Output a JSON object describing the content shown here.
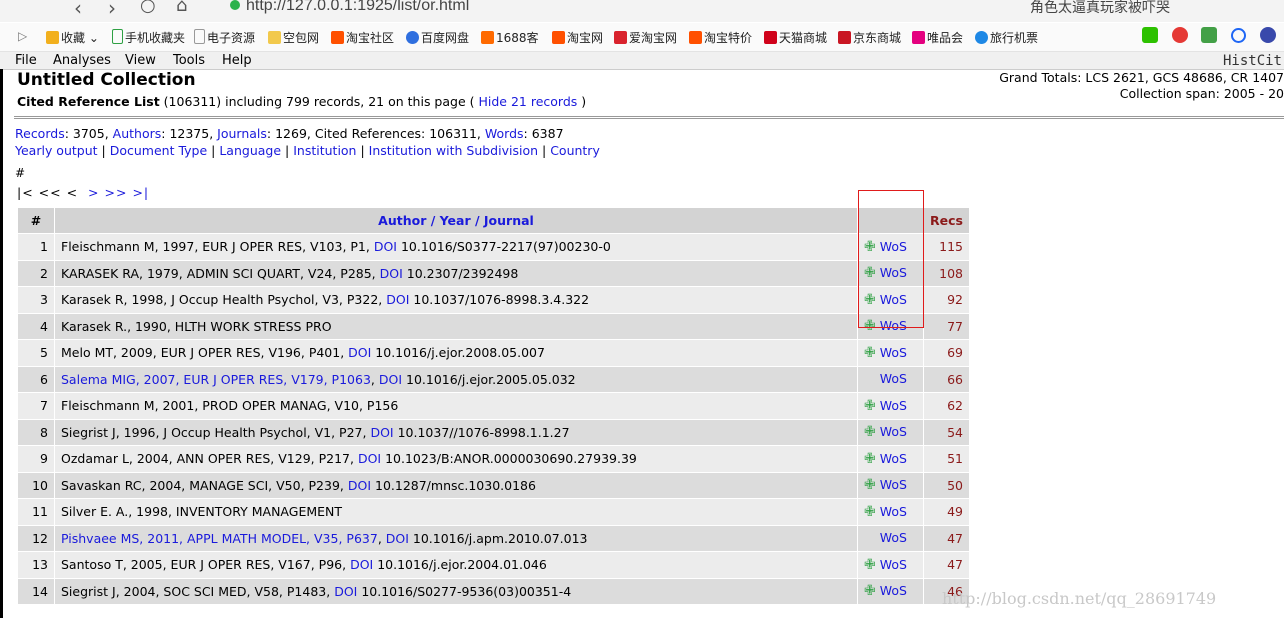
{
  "browser": {
    "url": "http://127.0.0.1:1925/list/or.html",
    "tab_title": "角色太逼真玩家被吓哭",
    "bookmarks": [
      "收藏",
      "手机收藏夹",
      "电子资源",
      "空包网",
      "淘宝社区",
      "百度网盘",
      "1688客",
      "淘宝网",
      "爱淘宝网",
      "淘宝特价",
      "天猫商城",
      "京东商城",
      "唯品会",
      "旅行机票"
    ]
  },
  "menu": {
    "items": [
      "File",
      "Analyses",
      "View",
      "Tools",
      "Help"
    ],
    "brand": "HistCit"
  },
  "header": {
    "title": "Untitled Collection",
    "cited_label": "Cited Reference List",
    "cited_info": " (106311) including 799 records, 21 on this page ( ",
    "hide_link": "Hide 21 records",
    "close_paren": " )",
    "grand_totals": "Grand Totals: LCS 2621, GCS 48686, CR 1407",
    "span": "Collection span: 2005 - 20"
  },
  "stats": {
    "records_label": "Records",
    "records_val": ": 3705, ",
    "authors_label": "Authors",
    "authors_val": ": 12375, ",
    "journals_label": "Journals",
    "journals_val": ": 1269, Cited References: 106311, ",
    "words_label": "Words",
    "words_val": ": 6387",
    "links": [
      "Yearly output",
      "Document Type",
      "Language",
      "Institution",
      "Institution with Subdivision",
      "Country"
    ]
  },
  "hash": "#",
  "pager": {
    "first": "|<",
    "prevprev": "<<",
    "prev": "<",
    "next": ">",
    "nextnext": ">>",
    "last": ">|"
  },
  "table": {
    "col_num": "#",
    "col_author": "Author",
    "col_year": "Year",
    "col_journal": "Journal",
    "col_recs": "Recs",
    "wos_label": "WoS",
    "plus_glyph": "✙",
    "rows": [
      {
        "n": "1",
        "ref": "Fleischmann M, 1997, EUR J OPER RES, V103, P1, ",
        "doi": "DOI",
        "doi_val": " 10.1016/S0377-2217(97)00230-0",
        "recs": "115",
        "plus": true,
        "linked": false
      },
      {
        "n": "2",
        "ref": "KARASEK RA, 1979, ADMIN SCI QUART, V24, P285, ",
        "doi": "DOI",
        "doi_val": " 10.2307/2392498",
        "recs": "108",
        "plus": true,
        "linked": false
      },
      {
        "n": "3",
        "ref": "Karasek R, 1998, J Occup Health Psychol, V3, P322, ",
        "doi": "DOI",
        "doi_val": " 10.1037/1076-8998.3.4.322",
        "recs": "92",
        "plus": true,
        "linked": false
      },
      {
        "n": "4",
        "ref": "Karasek R., 1990, HLTH WORK STRESS PRO",
        "doi": "",
        "doi_val": "",
        "recs": "77",
        "plus": true,
        "linked": false
      },
      {
        "n": "5",
        "ref": "Melo MT, 2009, EUR J OPER RES, V196, P401, ",
        "doi": "DOI",
        "doi_val": " 10.1016/j.ejor.2008.05.007",
        "recs": "69",
        "plus": true,
        "linked": false
      },
      {
        "n": "6",
        "ref": "Salema MIG, 2007, EUR J OPER RES, V179, P1063",
        "doi": "DOI",
        "doi_val": " 10.1016/j.ejor.2005.05.032",
        "recs": "66",
        "plus": false,
        "linked": true
      },
      {
        "n": "7",
        "ref": "Fleischmann M, 2001, PROD OPER MANAG, V10, P156",
        "doi": "",
        "doi_val": "",
        "recs": "62",
        "plus": true,
        "linked": false
      },
      {
        "n": "8",
        "ref": "Siegrist J, 1996, J Occup Health Psychol, V1, P27, ",
        "doi": "DOI",
        "doi_val": " 10.1037//1076-8998.1.1.27",
        "recs": "54",
        "plus": true,
        "linked": false
      },
      {
        "n": "9",
        "ref": "Ozdamar L, 2004, ANN OPER RES, V129, P217, ",
        "doi": "DOI",
        "doi_val": " 10.1023/B:ANOR.0000030690.27939.39",
        "recs": "51",
        "plus": true,
        "linked": false
      },
      {
        "n": "10",
        "ref": "Savaskan RC, 2004, MANAGE SCI, V50, P239, ",
        "doi": "DOI",
        "doi_val": " 10.1287/mnsc.1030.0186",
        "recs": "50",
        "plus": true,
        "linked": false
      },
      {
        "n": "11",
        "ref": "Silver E. A., 1998, INVENTORY MANAGEMENT",
        "doi": "",
        "doi_val": "",
        "recs": "49",
        "plus": true,
        "linked": false
      },
      {
        "n": "12",
        "ref": "Pishvaee MS, 2011, APPL MATH MODEL, V35, P637",
        "doi": "DOI",
        "doi_val": " 10.1016/j.apm.2010.07.013",
        "recs": "47",
        "plus": false,
        "linked": true
      },
      {
        "n": "13",
        "ref": "Santoso T, 2005, EUR J OPER RES, V167, P96, ",
        "doi": "DOI",
        "doi_val": " 10.1016/j.ejor.2004.01.046",
        "recs": "47",
        "plus": true,
        "linked": false
      },
      {
        "n": "14",
        "ref": "Siegrist J, 2004, SOC SCI MED, V58, P1483, ",
        "doi": "DOI",
        "doi_val": " 10.1016/S0277-9536(03)00351-4",
        "recs": "46",
        "plus": true,
        "linked": false
      }
    ]
  },
  "watermark": "http://blog.csdn.net/qq_28691749",
  "colors": {
    "link": "#1a1adb",
    "recs": "#8b1a1a",
    "plus": "#2ea043",
    "highlight_box": "#e01b1b"
  }
}
